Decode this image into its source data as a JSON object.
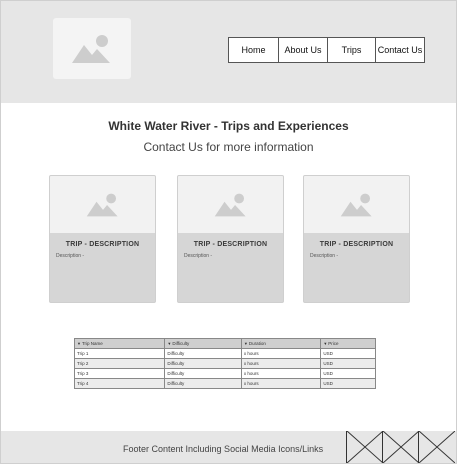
{
  "header": {
    "logo_icon": "image-placeholder-icon",
    "nav": [
      {
        "label": "Home"
      },
      {
        "label": "About Us"
      },
      {
        "label": "Trips"
      },
      {
        "label": "Contact Us"
      }
    ]
  },
  "main": {
    "title": "White Water River - Trips and Experiences",
    "subtitle": "Contact Us for more information"
  },
  "cards": [
    {
      "title": "TRIP - DESCRIPTION",
      "description": "Description -",
      "image_icon": "image-placeholder-icon"
    },
    {
      "title": "TRIP - DESCRIPTION",
      "description": "Description -",
      "image_icon": "image-placeholder-icon"
    },
    {
      "title": "TRIP - DESCRIPTION",
      "description": "Description -",
      "image_icon": "image-placeholder-icon"
    }
  ],
  "table": {
    "headers": [
      "Trip Name",
      "Difficulty",
      "Duration",
      "Price"
    ],
    "rows": [
      [
        "Trip 1",
        "Difficulty",
        "x hours",
        "USD"
      ],
      [
        "Trip 2",
        "Difficulty",
        "x hours",
        "USD"
      ],
      [
        "Trip 3",
        "Difficulty",
        "x hours",
        "USD"
      ],
      [
        "Trip 4",
        "Difficulty",
        "x hours",
        "USD"
      ]
    ]
  },
  "footer": {
    "text": "Footer Content Including Social Media Icons/Links",
    "social_icons": [
      "social-placeholder-icon",
      "social-placeholder-icon",
      "social-placeholder-icon"
    ]
  },
  "colors": {
    "header_bg": "#e6e6e6",
    "card_bg": "#d6d6d6",
    "placeholder_bg": "#f2f2f2",
    "icon": "#cdcdcd"
  }
}
